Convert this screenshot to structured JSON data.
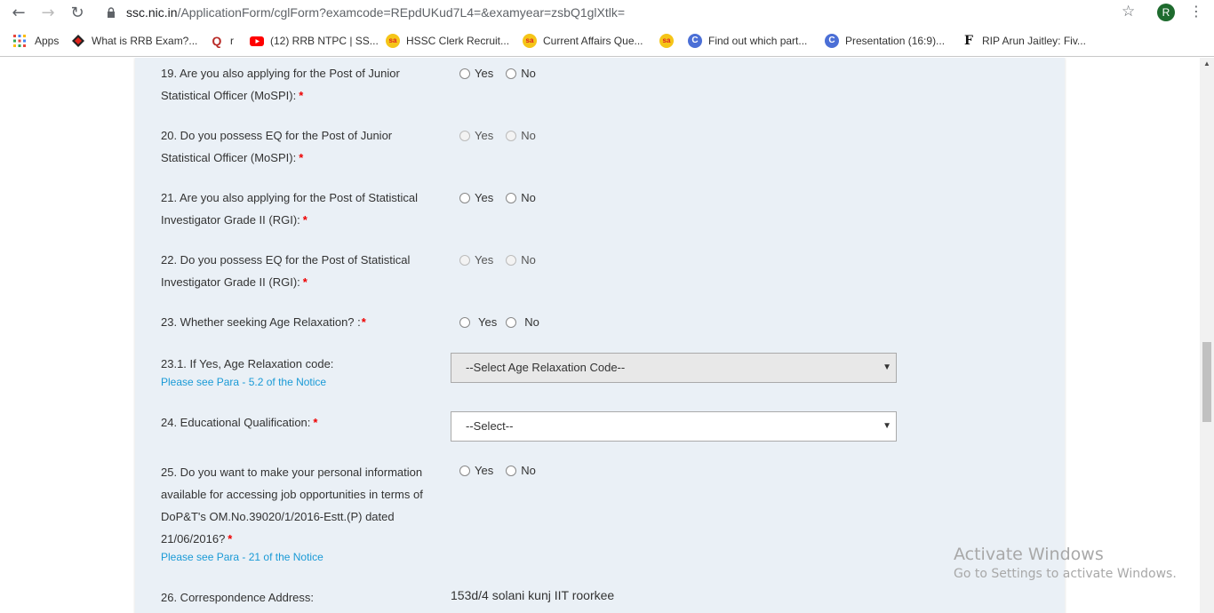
{
  "browser": {
    "url_host": "ssc.nic.in",
    "url_path": "/ApplicationForm/cglForm?examcode=REpdUKud7L4=&examyear=zsbQ1glXtlk=",
    "avatar_letter": "R",
    "bookmarks": [
      {
        "label": "Apps",
        "icon": "apps-grid-icon"
      },
      {
        "label": "What is RRB Exam?...",
        "icon": "red-diamond-icon"
      },
      {
        "label": "r",
        "icon": "q-logo-icon"
      },
      {
        "label": "(12) RRB NTPC | SS...",
        "icon": "youtube-icon"
      },
      {
        "label": "HSSC Clerk Recruit...",
        "icon": "sa-icon"
      },
      {
        "label": "Current Affairs Que...",
        "icon": "sa-icon"
      },
      {
        "label": "",
        "icon": "sa-icon"
      },
      {
        "label": "Find out which part...",
        "icon": "c-logo-icon"
      },
      {
        "label": "Presentation (16:9)...",
        "icon": "c-logo-icon"
      },
      {
        "label": "RIP Arun Jaitley: Fiv...",
        "icon": "f-logo-icon"
      }
    ]
  },
  "form": {
    "q19": {
      "text": "19. Are you also applying for the Post of Junior Statistical Officer (MoSPI):",
      "yes": "Yes",
      "no": "No"
    },
    "q20": {
      "text": "20. Do you possess EQ for the Post of Junior Statistical Officer (MoSPI):",
      "yes": "Yes",
      "no": "No"
    },
    "q21": {
      "text": "21. Are you also applying for the Post of Statistical Investigator Grade II (RGI):",
      "yes": "Yes",
      "no": "No"
    },
    "q22": {
      "text": "22. Do you possess EQ for the Post of Statistical Investigator Grade II (RGI):",
      "yes": "Yes",
      "no": "No"
    },
    "q23": {
      "text": "23. Whether seeking Age Relaxation? :",
      "yes": "Yes",
      "no": "No"
    },
    "q23_1": {
      "text": "23.1. If Yes, Age Relaxation code:",
      "note": "Please see Para - 5.2 of the Notice",
      "select_value": "--Select Age Relaxation Code--"
    },
    "q24": {
      "text": "24. Educational Qualification:",
      "select_value": "--Select--"
    },
    "q25": {
      "text": "25. Do you want to make your personal information available for accessing job opportunities in terms of DoP&T's OM.No.39020/1/2016-Estt.(P) dated 21/06/2016?",
      "note": "Please see Para - 21 of the Notice",
      "yes": "Yes",
      "no": "No"
    },
    "q26": {
      "text": "26. Correspondence Address:",
      "value": "153d/4 solani kunj IIT roorkee"
    },
    "required_mark": "*"
  },
  "watermark": {
    "title": "Activate Windows",
    "subtitle": "Go to Settings to activate Windows."
  }
}
